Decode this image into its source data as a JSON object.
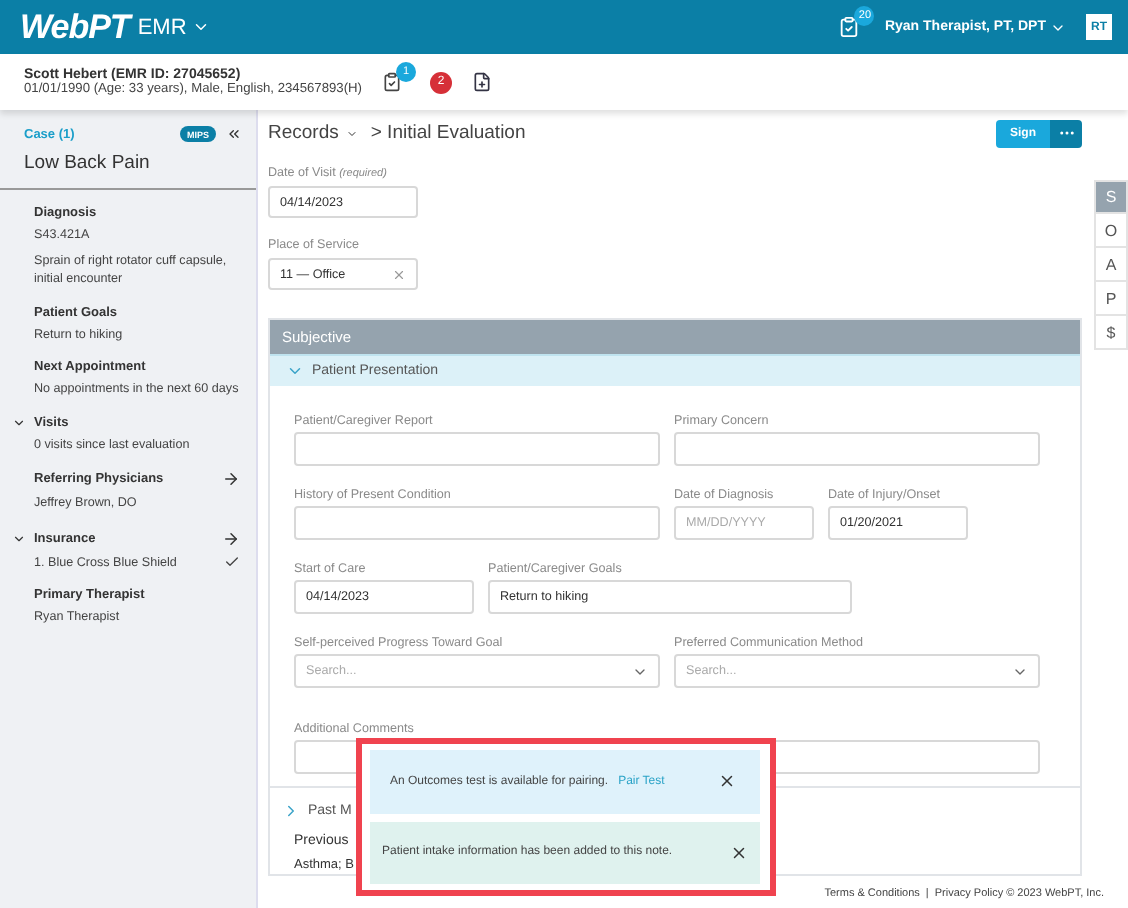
{
  "header": {
    "logo": "WebPT",
    "product": "EMR",
    "task_count": "20",
    "user": "Ryan Therapist, PT, DPT",
    "initials": "RT"
  },
  "patient": {
    "name": "Scott Hebert (EMR ID: 27045652)",
    "details": "01/01/1990 (Age: 33 years), Male, English, 234567893(H)",
    "task_count": "1",
    "alert_count": "2"
  },
  "sidebar": {
    "case": "Case (1)",
    "badge": "MIPS",
    "title": "Low Back Pain",
    "sections": [
      {
        "kind": "plain",
        "heading": "Diagnosis",
        "lines": [
          {
            "text": "S43.421A"
          },
          {
            "text": "Sprain of right rotator cuff capsule, initial encounter"
          }
        ]
      },
      {
        "kind": "plain",
        "heading": "Patient Goals",
        "lines": [
          {
            "text": "Return to hiking"
          }
        ]
      },
      {
        "kind": "plain",
        "heading": "Next Appointment",
        "lines": [
          {
            "text": "No appointments in the next 60 days"
          }
        ]
      },
      {
        "kind": "expandable",
        "heading": "Visits",
        "expanded": true,
        "lines": [
          {
            "text": "0 visits since last evaluation"
          }
        ]
      },
      {
        "kind": "link",
        "heading": "Referring Physicians",
        "lines": [
          {
            "text": "Jeffrey Brown, DO"
          }
        ]
      },
      {
        "kind": "expandable_link",
        "heading": "Insurance",
        "expanded": true,
        "lines": [
          {
            "text": "1. Blue Cross Blue Shield",
            "checked": true
          }
        ]
      },
      {
        "kind": "plain",
        "heading": "Primary Therapist",
        "lines": [
          {
            "text": "Ryan Therapist"
          }
        ]
      }
    ]
  },
  "breadcrumb": {
    "root": "Records",
    "current": "> Initial Evaluation"
  },
  "sign_button": "Sign",
  "date_of_visit": {
    "label": "Date of Visit",
    "hint": "(required)",
    "value": "04/14/2023"
  },
  "place_of_service": {
    "label": "Place of Service",
    "value": "11 — Office"
  },
  "soap_tabs": [
    {
      "label": "S",
      "selected": true
    },
    {
      "label": "O",
      "selected": false
    },
    {
      "label": "A",
      "selected": false
    },
    {
      "label": "P",
      "selected": false
    },
    {
      "label": "$",
      "selected": false
    }
  ],
  "subjective": {
    "title": "Subjective",
    "subsection": {
      "title": "Patient Presentation",
      "expanded": true
    },
    "rows": [
      [
        {
          "kind": "textarea",
          "label": "Patient/Caregiver Report"
        },
        {
          "kind": "textarea",
          "label": "Primary Concern"
        }
      ],
      [
        {
          "kind": "textarea",
          "label": "History of Present Condition"
        },
        {
          "kind": "input",
          "label": "Date of Diagnosis",
          "placeholder": "MM/DD/YYYY"
        },
        {
          "kind": "input",
          "label": "Date of Injury/Onset",
          "value": "01/20/2021"
        }
      ],
      [
        {
          "kind": "input",
          "label": "Start of Care",
          "value": "04/14/2023"
        },
        {
          "kind": "textarea",
          "label": "Patient/Caregiver Goals",
          "value": "Return to hiking"
        }
      ],
      [
        {
          "kind": "select",
          "label": "Self-perceived Progress Toward Goal",
          "placeholder": "Search..."
        },
        {
          "kind": "select",
          "label": "Preferred Communication Method",
          "placeholder": "Search..."
        }
      ],
      [
        {
          "kind": "textarea",
          "label": "Additional Comments"
        }
      ]
    ],
    "collapsed_section": {
      "title": "Past M",
      "expanded": false
    },
    "previous_label": "Previous",
    "previous_value": "Asthma; B"
  },
  "toasts": [
    {
      "kind": "info",
      "text": "An Outcomes test is available for pairing.",
      "link": "Pair Test"
    },
    {
      "kind": "success",
      "text": "Patient intake information has been added to this note."
    }
  ],
  "footer": {
    "terms": "Terms & Conditions",
    "separator": "|",
    "privacy": "Privacy Policy © 2023 WebPT, Inc."
  }
}
